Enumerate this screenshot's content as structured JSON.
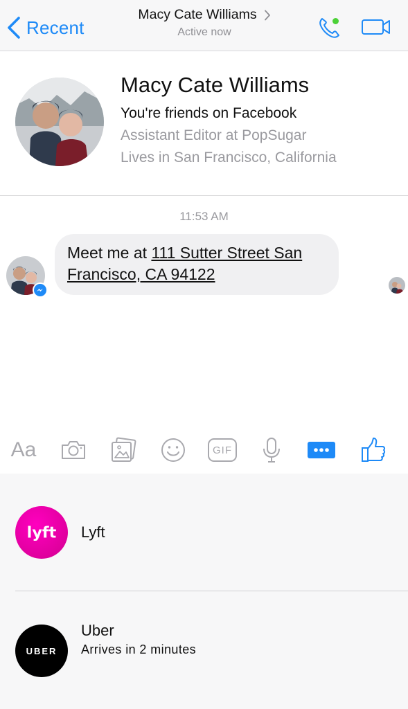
{
  "header": {
    "back_label": "Recent",
    "contact_name": "Macy Cate Williams",
    "status": "Active now",
    "colors": {
      "accent": "#1e8af7",
      "online": "#4cd137"
    }
  },
  "profile": {
    "name": "Macy Cate Williams",
    "friendship": "You're friends on Facebook",
    "job": "Assistant Editor at PopSugar",
    "location": "Lives in San Francisco, California"
  },
  "thread": {
    "timestamp": "11:53 AM",
    "message_prefix": "Meet me at ",
    "message_address": "111 Sutter Street San Francisco, CA 94122"
  },
  "toolbar": {
    "text_label": "Aa",
    "gif_label": "GIF",
    "icons": [
      "text-icon",
      "camera-icon",
      "photo-icon",
      "emoji-icon",
      "gif-icon",
      "microphone-icon",
      "more-icon",
      "like-icon"
    ]
  },
  "apps": [
    {
      "name": "Lyft",
      "icon_text": "lyft",
      "subtitle": "",
      "color": "#ff00bf"
    },
    {
      "name": "Uber",
      "icon_text": "UBER",
      "subtitle": "Arrives in 2 minutes",
      "color": "#000000"
    }
  ]
}
